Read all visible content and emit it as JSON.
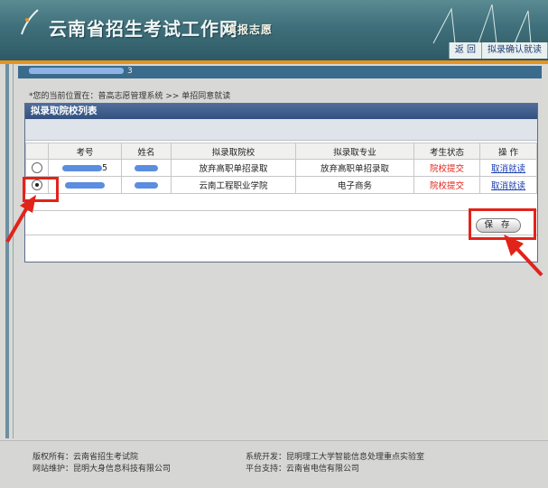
{
  "banner": {
    "site_title": "云南省招生考试工作网",
    "section_title": "填报志愿",
    "nav": [
      "返 回",
      "拟录确认就读"
    ]
  },
  "user_info": "3",
  "breadcrumb": "*您的当前位置在：普高志愿管理系统 >> 单招同意就读",
  "panel": {
    "title": "拟录取院校列表",
    "columns": [
      "",
      "考号",
      "姓名",
      "拟录取院校",
      "拟录取专业",
      "考生状态",
      "操 作"
    ],
    "rows": [
      {
        "selected": false,
        "exam_no_suffix": "5",
        "name_suffix": "",
        "school": "放弃高职单招录取",
        "major": "放弃高职单招录取",
        "status": "院校提交",
        "action": "取消就读"
      },
      {
        "selected": true,
        "exam_no_suffix": "",
        "name_suffix": "",
        "school": "云南工程职业学院",
        "major": "电子商务",
        "status": "院校提交",
        "action": "取消就读"
      }
    ],
    "save_label": "保 存"
  },
  "footer": {
    "left": [
      "版权所有：云南省招生考试院",
      "网站维护：昆明大身信息科技有限公司"
    ],
    "right": [
      "系统开发：昆明理工大学智能信息处理重点实验室",
      "平台支持：云南省电信有限公司"
    ]
  },
  "colors": {
    "banner": "#3f6f7a",
    "accent_orange": "#e8931e",
    "panel_header": "#34507e",
    "status_red": "#e0261b",
    "highlight": "#e2231a"
  }
}
